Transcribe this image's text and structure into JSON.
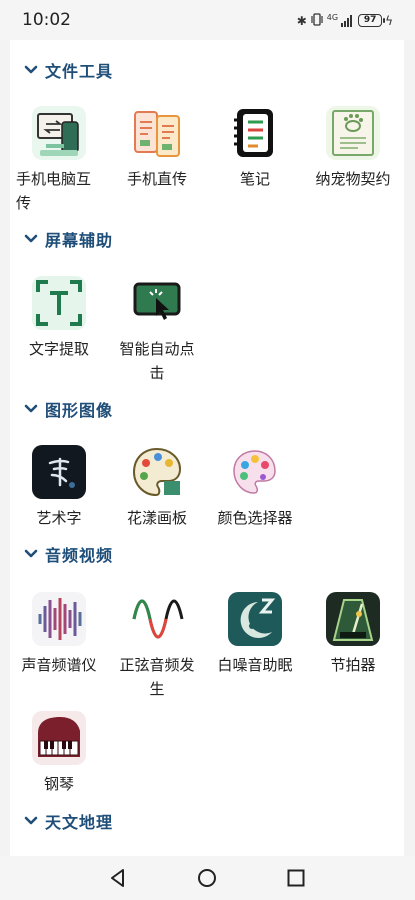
{
  "status_bar": {
    "time": "10:02",
    "network_label": "4G",
    "battery": "97",
    "icons": [
      "bluetooth-icon",
      "vibrate-icon",
      "signal-icon",
      "battery-icon",
      "charging-icon"
    ]
  },
  "categories": [
    {
      "title": "文件工具",
      "tools": [
        {
          "label": "手机电脑互传",
          "icon": "phone-pc-transfer-icon"
        },
        {
          "label": "手机直传",
          "icon": "phone-direct-transfer-icon"
        },
        {
          "label": "笔记",
          "icon": "notebook-icon"
        },
        {
          "label": "纳宠物契约",
          "icon": "pet-contract-icon"
        }
      ]
    },
    {
      "title": "屏幕辅助",
      "tools": [
        {
          "label": "文字提取",
          "icon": "text-extract-icon"
        },
        {
          "label": "智能自动点击",
          "icon": "auto-click-icon"
        }
      ]
    },
    {
      "title": "图形图像",
      "tools": [
        {
          "label": "艺术字",
          "icon": "art-text-icon"
        },
        {
          "label": "花漾画板",
          "icon": "drawing-board-icon"
        },
        {
          "label": "颜色选择器",
          "icon": "color-picker-icon"
        }
      ]
    },
    {
      "title": "音频视频",
      "tools": [
        {
          "label": "声音频谱仪",
          "icon": "spectrum-analyzer-icon"
        },
        {
          "label": "正弦音频发生",
          "icon": "sine-generator-icon"
        },
        {
          "label": "白噪音助眠",
          "icon": "white-noise-sleep-icon"
        },
        {
          "label": "节拍器",
          "icon": "metronome-icon"
        },
        {
          "label": "钢琴",
          "icon": "piano-icon"
        }
      ]
    },
    {
      "title": "天文地理",
      "tools": []
    }
  ],
  "nav_bar": {
    "icons": [
      "back-icon",
      "home-icon",
      "recents-icon"
    ]
  }
}
